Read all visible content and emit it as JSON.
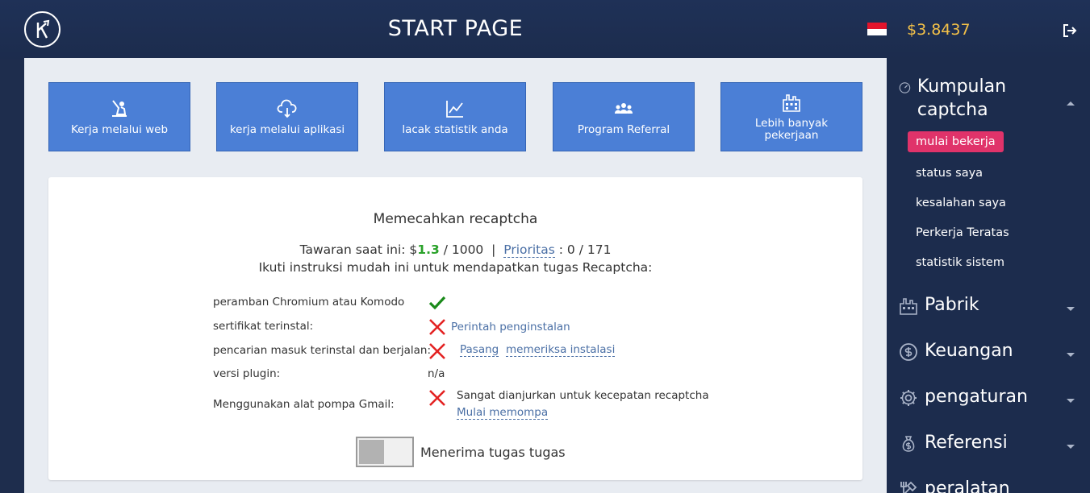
{
  "header": {
    "title": "START PAGE",
    "balance": "$3.8437",
    "logo_icon": "kolotibablo-logo-icon",
    "flag_icon": "indonesia-flag-icon",
    "logout_icon": "logout-icon"
  },
  "tiles": [
    {
      "label": "Kerja melalui web",
      "icon": "worker-icon"
    },
    {
      "label": "kerja melalui aplikasi",
      "icon": "cloud-download-icon"
    },
    {
      "label": "lacak statistik anda",
      "icon": "chart-icon"
    },
    {
      "label": "Program Referral",
      "icon": "people-icon"
    },
    {
      "label": "Lebih banyak pekerjaan",
      "icon": "factory-icon"
    }
  ],
  "card": {
    "title": "Memecahkan recaptcha",
    "offer_prefix": "Tawaran saat ini: $",
    "offer_value": "1.3",
    "offer_suffix": " / 1000",
    "separator": "|",
    "priority_label": "Prioritas",
    "priority_value": ": 0 / 171",
    "instructions": "Ikuti instruksi mudah ini untuk mendapatkan tugas Recaptcha:",
    "rows": {
      "browser": {
        "label": "peramban Chromium atau Komodo"
      },
      "certificate": {
        "label": "sertifikat terinstal:",
        "link": "Perintah penginstalan"
      },
      "plugin_running": {
        "label": "pencarian masuk terinstal dan berjalan:",
        "link1": "Pasang",
        "link2": "memeriksa instalasi"
      },
      "plugin_version": {
        "label": "versi plugin:",
        "value": "n/a"
      },
      "gmail_pump": {
        "label": "Menggunakan alat pompa Gmail:",
        "note": "Sangat dianjurkan untuk kecepatan recaptcha",
        "link": "Mulai memompa"
      }
    },
    "toggle_label": "Menerima tugas tugas"
  },
  "colors": {
    "header_bg": "#1f3157",
    "sidebar_bg": "#1c2c4d",
    "tile_bg": "#4b7fd6",
    "balance": "#f4c148",
    "active_pink": "#e0336a",
    "check_green": "#1a8a1a",
    "x_red": "#e32222"
  },
  "sidebar": {
    "sections": [
      {
        "title": "Kumpulan captcha",
        "icon": "gauge-icon",
        "expanded": true
      },
      {
        "title": "Pabrik",
        "icon": "factory-icon"
      },
      {
        "title": "Keuangan",
        "icon": "dollar-icon"
      },
      {
        "title": "pengaturan",
        "icon": "gear-icon"
      },
      {
        "title": "Referensi",
        "icon": "money-bag-icon"
      },
      {
        "title": "peralatan",
        "icon": "tools-icon"
      }
    ],
    "sub_items": [
      {
        "label": "mulai bekerja",
        "active": true
      },
      {
        "label": "status saya"
      },
      {
        "label": "kesalahan saya"
      },
      {
        "label": "Perkerja Teratas"
      },
      {
        "label": "statistik sistem"
      }
    ]
  }
}
